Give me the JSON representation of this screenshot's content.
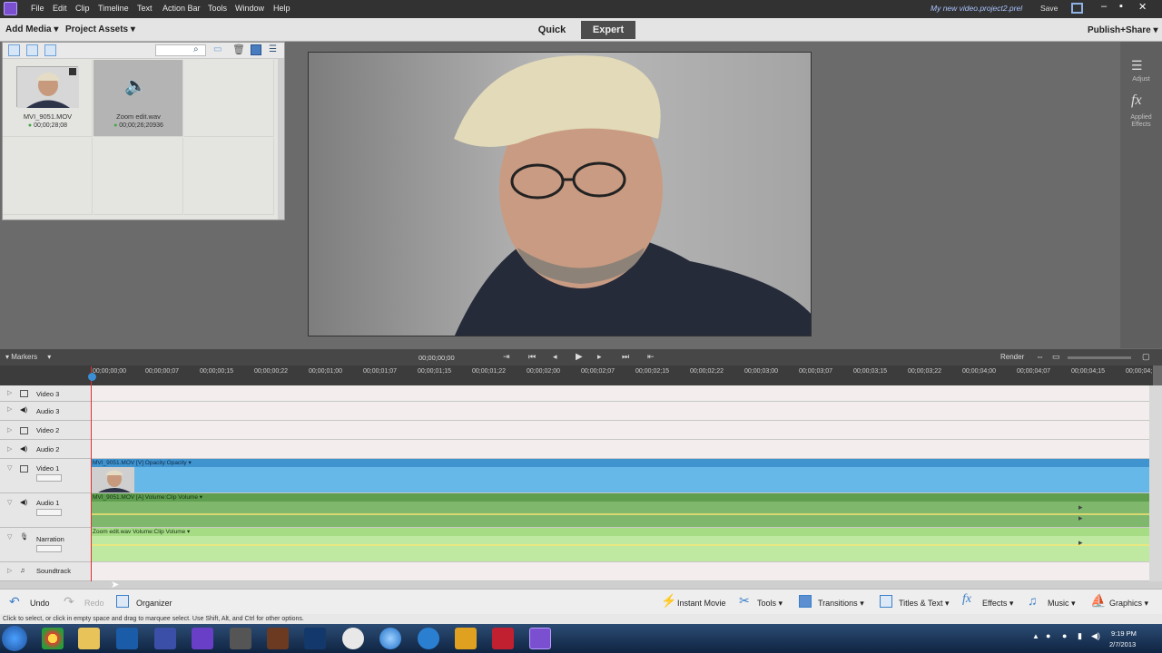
{
  "menubar": {
    "items": [
      "File",
      "Edit",
      "Clip",
      "Timeline",
      "Text",
      "Action Bar",
      "Tools",
      "Window",
      "Help"
    ],
    "project_name": "My new video.project2.prel",
    "save_label": "Save"
  },
  "toolbar": {
    "add_media": "Add Media",
    "project_assets": "Project Assets",
    "tab_quick": "Quick",
    "tab_expert": "Expert",
    "publish_share": "Publish+Share"
  },
  "assets": {
    "items": [
      {
        "name": "MVI_9051.MOV",
        "duration": "00;00;28;08"
      },
      {
        "name": "Zoom edit.wav",
        "duration": "00;00;26;20936"
      }
    ]
  },
  "right_panel": {
    "adjust": "Adjust",
    "applied_effects": "Applied Effects"
  },
  "markers_bar": {
    "markers": "Markers",
    "timecode": "00;00;00;00",
    "render": "Render"
  },
  "ruler": {
    "ticks": [
      "00;00;00;00",
      "00;00;00;07",
      "00;00;00;15",
      "00;00;00;22",
      "00;00;01;00",
      "00;00;01;07",
      "00;00;01;15",
      "00;00;01;22",
      "00;00;02;00",
      "00;00;02;07",
      "00;00;02;15",
      "00;00;02;22",
      "00;00;03;00",
      "00;00;03;07",
      "00;00;03;15",
      "00;00;03;22",
      "00;00;04;00",
      "00;00;04;07",
      "00;00;04;15",
      "00;00;04;"
    ]
  },
  "tracks": {
    "video3": "Video 3",
    "audio3": "Audio 3",
    "video2": "Video 2",
    "audio2": "Audio 2",
    "video1": "Video 1",
    "audio1": "Audio 1",
    "narration": "Narration",
    "soundtrack": "Soundtrack"
  },
  "clips": {
    "video1_label": "MVI_9051.MOV [V]  Opacity:Opacity ▾",
    "audio1_label": "MVI_9051.MOV [A]  Volume:Clip Volume ▾",
    "narration_label": "Zoom edit.wav  Volume:Clip Volume ▾"
  },
  "action_bar": {
    "undo": "Undo",
    "redo": "Redo",
    "organizer": "Organizer",
    "instant_movie": "Instant Movie",
    "tools": "Tools",
    "transitions": "Transitions",
    "titles_text": "Titles & Text",
    "effects": "Effects",
    "music": "Music",
    "graphics": "Graphics"
  },
  "status": "Click to select, or click in empty space and drag to marquee select. Use Shift, Alt, and Ctrl for other options.",
  "clock": {
    "time": "9:19 PM",
    "date": "2/7/2013"
  },
  "colors": {
    "video_clip": "#66b8e8",
    "audio_clip": "#7fb86c",
    "narration_clip": "#bfe8a0",
    "playhead": "#e03030"
  }
}
